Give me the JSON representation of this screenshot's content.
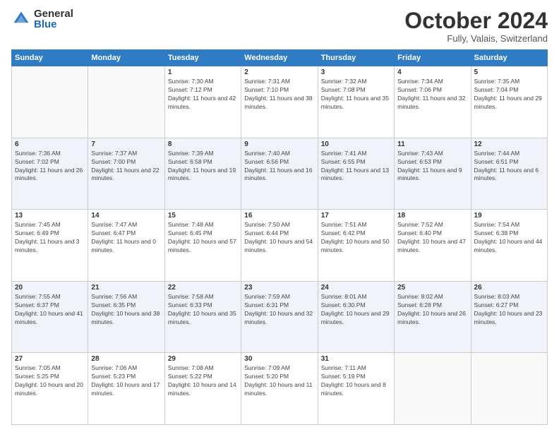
{
  "logo": {
    "general": "General",
    "blue": "Blue"
  },
  "title": "October 2024",
  "subtitle": "Fully, Valais, Switzerland",
  "headers": [
    "Sunday",
    "Monday",
    "Tuesday",
    "Wednesday",
    "Thursday",
    "Friday",
    "Saturday"
  ],
  "weeks": [
    [
      {
        "num": "",
        "sunrise": "",
        "sunset": "",
        "daylight": ""
      },
      {
        "num": "",
        "sunrise": "",
        "sunset": "",
        "daylight": ""
      },
      {
        "num": "1",
        "sunrise": "Sunrise: 7:30 AM",
        "sunset": "Sunset: 7:12 PM",
        "daylight": "Daylight: 11 hours and 42 minutes."
      },
      {
        "num": "2",
        "sunrise": "Sunrise: 7:31 AM",
        "sunset": "Sunset: 7:10 PM",
        "daylight": "Daylight: 11 hours and 38 minutes."
      },
      {
        "num": "3",
        "sunrise": "Sunrise: 7:32 AM",
        "sunset": "Sunset: 7:08 PM",
        "daylight": "Daylight: 11 hours and 35 minutes."
      },
      {
        "num": "4",
        "sunrise": "Sunrise: 7:34 AM",
        "sunset": "Sunset: 7:06 PM",
        "daylight": "Daylight: 11 hours and 32 minutes."
      },
      {
        "num": "5",
        "sunrise": "Sunrise: 7:35 AM",
        "sunset": "Sunset: 7:04 PM",
        "daylight": "Daylight: 11 hours and 29 minutes."
      }
    ],
    [
      {
        "num": "6",
        "sunrise": "Sunrise: 7:36 AM",
        "sunset": "Sunset: 7:02 PM",
        "daylight": "Daylight: 11 hours and 26 minutes."
      },
      {
        "num": "7",
        "sunrise": "Sunrise: 7:37 AM",
        "sunset": "Sunset: 7:00 PM",
        "daylight": "Daylight: 11 hours and 22 minutes."
      },
      {
        "num": "8",
        "sunrise": "Sunrise: 7:39 AM",
        "sunset": "Sunset: 6:58 PM",
        "daylight": "Daylight: 11 hours and 19 minutes."
      },
      {
        "num": "9",
        "sunrise": "Sunrise: 7:40 AM",
        "sunset": "Sunset: 6:56 PM",
        "daylight": "Daylight: 11 hours and 16 minutes."
      },
      {
        "num": "10",
        "sunrise": "Sunrise: 7:41 AM",
        "sunset": "Sunset: 6:55 PM",
        "daylight": "Daylight: 11 hours and 13 minutes."
      },
      {
        "num": "11",
        "sunrise": "Sunrise: 7:43 AM",
        "sunset": "Sunset: 6:53 PM",
        "daylight": "Daylight: 11 hours and 9 minutes."
      },
      {
        "num": "12",
        "sunrise": "Sunrise: 7:44 AM",
        "sunset": "Sunset: 6:51 PM",
        "daylight": "Daylight: 11 hours and 6 minutes."
      }
    ],
    [
      {
        "num": "13",
        "sunrise": "Sunrise: 7:45 AM",
        "sunset": "Sunset: 6:49 PM",
        "daylight": "Daylight: 11 hours and 3 minutes."
      },
      {
        "num": "14",
        "sunrise": "Sunrise: 7:47 AM",
        "sunset": "Sunset: 6:47 PM",
        "daylight": "Daylight: 11 hours and 0 minutes."
      },
      {
        "num": "15",
        "sunrise": "Sunrise: 7:48 AM",
        "sunset": "Sunset: 6:45 PM",
        "daylight": "Daylight: 10 hours and 57 minutes."
      },
      {
        "num": "16",
        "sunrise": "Sunrise: 7:50 AM",
        "sunset": "Sunset: 6:44 PM",
        "daylight": "Daylight: 10 hours and 54 minutes."
      },
      {
        "num": "17",
        "sunrise": "Sunrise: 7:51 AM",
        "sunset": "Sunset: 6:42 PM",
        "daylight": "Daylight: 10 hours and 50 minutes."
      },
      {
        "num": "18",
        "sunrise": "Sunrise: 7:52 AM",
        "sunset": "Sunset: 6:40 PM",
        "daylight": "Daylight: 10 hours and 47 minutes."
      },
      {
        "num": "19",
        "sunrise": "Sunrise: 7:54 AM",
        "sunset": "Sunset: 6:38 PM",
        "daylight": "Daylight: 10 hours and 44 minutes."
      }
    ],
    [
      {
        "num": "20",
        "sunrise": "Sunrise: 7:55 AM",
        "sunset": "Sunset: 6:37 PM",
        "daylight": "Daylight: 10 hours and 41 minutes."
      },
      {
        "num": "21",
        "sunrise": "Sunrise: 7:56 AM",
        "sunset": "Sunset: 6:35 PM",
        "daylight": "Daylight: 10 hours and 38 minutes."
      },
      {
        "num": "22",
        "sunrise": "Sunrise: 7:58 AM",
        "sunset": "Sunset: 6:33 PM",
        "daylight": "Daylight: 10 hours and 35 minutes."
      },
      {
        "num": "23",
        "sunrise": "Sunrise: 7:59 AM",
        "sunset": "Sunset: 6:31 PM",
        "daylight": "Daylight: 10 hours and 32 minutes."
      },
      {
        "num": "24",
        "sunrise": "Sunrise: 8:01 AM",
        "sunset": "Sunset: 6:30 PM",
        "daylight": "Daylight: 10 hours and 29 minutes."
      },
      {
        "num": "25",
        "sunrise": "Sunrise: 8:02 AM",
        "sunset": "Sunset: 6:28 PM",
        "daylight": "Daylight: 10 hours and 26 minutes."
      },
      {
        "num": "26",
        "sunrise": "Sunrise: 8:03 AM",
        "sunset": "Sunset: 6:27 PM",
        "daylight": "Daylight: 10 hours and 23 minutes."
      }
    ],
    [
      {
        "num": "27",
        "sunrise": "Sunrise: 7:05 AM",
        "sunset": "Sunset: 5:25 PM",
        "daylight": "Daylight: 10 hours and 20 minutes."
      },
      {
        "num": "28",
        "sunrise": "Sunrise: 7:06 AM",
        "sunset": "Sunset: 5:23 PM",
        "daylight": "Daylight: 10 hours and 17 minutes."
      },
      {
        "num": "29",
        "sunrise": "Sunrise: 7:08 AM",
        "sunset": "Sunset: 5:22 PM",
        "daylight": "Daylight: 10 hours and 14 minutes."
      },
      {
        "num": "30",
        "sunrise": "Sunrise: 7:09 AM",
        "sunset": "Sunset: 5:20 PM",
        "daylight": "Daylight: 10 hours and 11 minutes."
      },
      {
        "num": "31",
        "sunrise": "Sunrise: 7:11 AM",
        "sunset": "Sunset: 5:19 PM",
        "daylight": "Daylight: 10 hours and 8 minutes."
      },
      {
        "num": "",
        "sunrise": "",
        "sunset": "",
        "daylight": ""
      },
      {
        "num": "",
        "sunrise": "",
        "sunset": "",
        "daylight": ""
      }
    ]
  ]
}
